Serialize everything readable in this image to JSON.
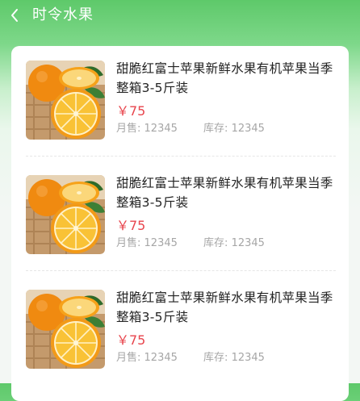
{
  "header": {
    "title": "时令水果",
    "back_icon": "chevron-left-icon"
  },
  "colors": {
    "header_green": "#5ec96a",
    "price_red": "#e8454d",
    "meta_gray": "#a6a6a6"
  },
  "products": [
    {
      "title": "甜脆红富士苹果新鲜水果有机苹果当季整箱3-5斤装",
      "price": "￥75",
      "sales_label": "月售:",
      "sales": "12345",
      "stock_label": "库存:",
      "stock": "12345",
      "image": "orange-fruit-image"
    },
    {
      "title": "甜脆红富士苹果新鲜水果有机苹果当季整箱3-5斤装",
      "price": "￥75",
      "sales_label": "月售:",
      "sales": "12345",
      "stock_label": "库存:",
      "stock": "12345",
      "image": "orange-fruit-image"
    },
    {
      "title": "甜脆红富士苹果新鲜水果有机苹果当季整箱3-5斤装",
      "price": "￥75",
      "sales_label": "月售:",
      "sales": "12345",
      "stock_label": "库存:",
      "stock": "12345",
      "image": "orange-fruit-image"
    }
  ]
}
